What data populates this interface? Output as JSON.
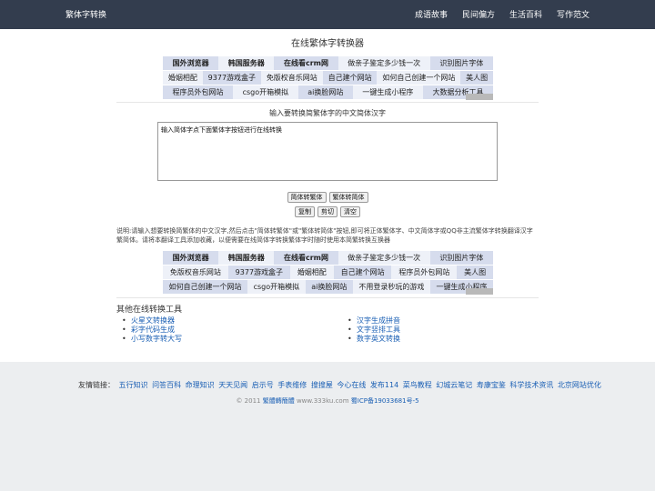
{
  "header": {
    "brand": "繁体字转换",
    "nav": [
      "成语故事",
      "民间偏方",
      "生活百科",
      "写作范文"
    ]
  },
  "page_title": "在线繁体字转换器",
  "ad_top": {
    "rows": [
      [
        "国外浏览器",
        "韩国服务器",
        "在线看crm网",
        "做亲子鉴定多少钱一次",
        "识别图片字体"
      ],
      [
        "婚姻相配",
        "9377游戏盒子",
        "免版权音乐网站",
        "自己建个网站",
        "如何自己创建一个网站",
        "美人图"
      ],
      [
        "程序员外包网站",
        "csgo开箱模拟",
        "ai换脸网站",
        "一键生成小程序",
        "大数据分析工具"
      ]
    ]
  },
  "input": {
    "label": "输入要转换简繁体字的中文简体汉字",
    "value": "输入简体字点下面繁体字按钮进行在线转换"
  },
  "buttons": {
    "to_traditional": "简体转繁体",
    "to_simplified": "繁体转简体",
    "copy": "复制",
    "cut": "剪切",
    "clear": "清空"
  },
  "description": "说明:请输入想要转换简繁体的中文汉字,然后点击\"简体转繁体\"或\"繁体转简体\"按钮,即可将正体繁体字、中文简体字或QQ非主流繁体字转换翻译汉字繁简体。请将本翻译工具添加收藏，以便需要在线简体字转换繁体字时随时使用本简繁转换互换器",
  "ad_bottom": {
    "rows": [
      [
        "国外浏览器",
        "韩国服务器",
        "在线看crm网",
        "做亲子鉴定多少钱一次",
        "识别图片字体"
      ],
      [
        "免版权音乐网站",
        "9377游戏盒子",
        "婚姻相配",
        "自己建个网站",
        "程序员外包网站",
        "美人图"
      ],
      [
        "如何自己创建一个网站",
        "csgo开箱模拟",
        "ai换脸网站",
        "不用登录秒玩的游戏",
        "一键生成小程序"
      ]
    ]
  },
  "tools": {
    "title": "其他在线转换工具",
    "left": [
      "火星文转换器",
      "彩字代码生成",
      "小写数字转大写"
    ],
    "right": [
      "汉字生成拼音",
      "文字竖排工具",
      "数字英文转换"
    ]
  },
  "footer": {
    "friend_label": "友情链接：",
    "friend_links": [
      "五行知识",
      "问答百科",
      "命理知识",
      "天天见闻",
      "启示号",
      "手表维修",
      "搜搜屋",
      "今心在线",
      "发布114",
      "菜鸟教程",
      "幻城云笔记",
      "寿康宝鉴",
      "科学技术资讯",
      "北京网站优化"
    ],
    "copyright_prefix": "© 2011",
    "copyright_name": "繁體轉簡體",
    "copyright_site": "www.333ku.com",
    "icp": "蜀ICP备19033681号-5"
  },
  "colors": {
    "header_bg": "#333d4e",
    "ad_dark": "#d6dced",
    "ad_light": "#eef1f8",
    "link": "#1a5fb4",
    "footer_bg": "#eceef0"
  }
}
